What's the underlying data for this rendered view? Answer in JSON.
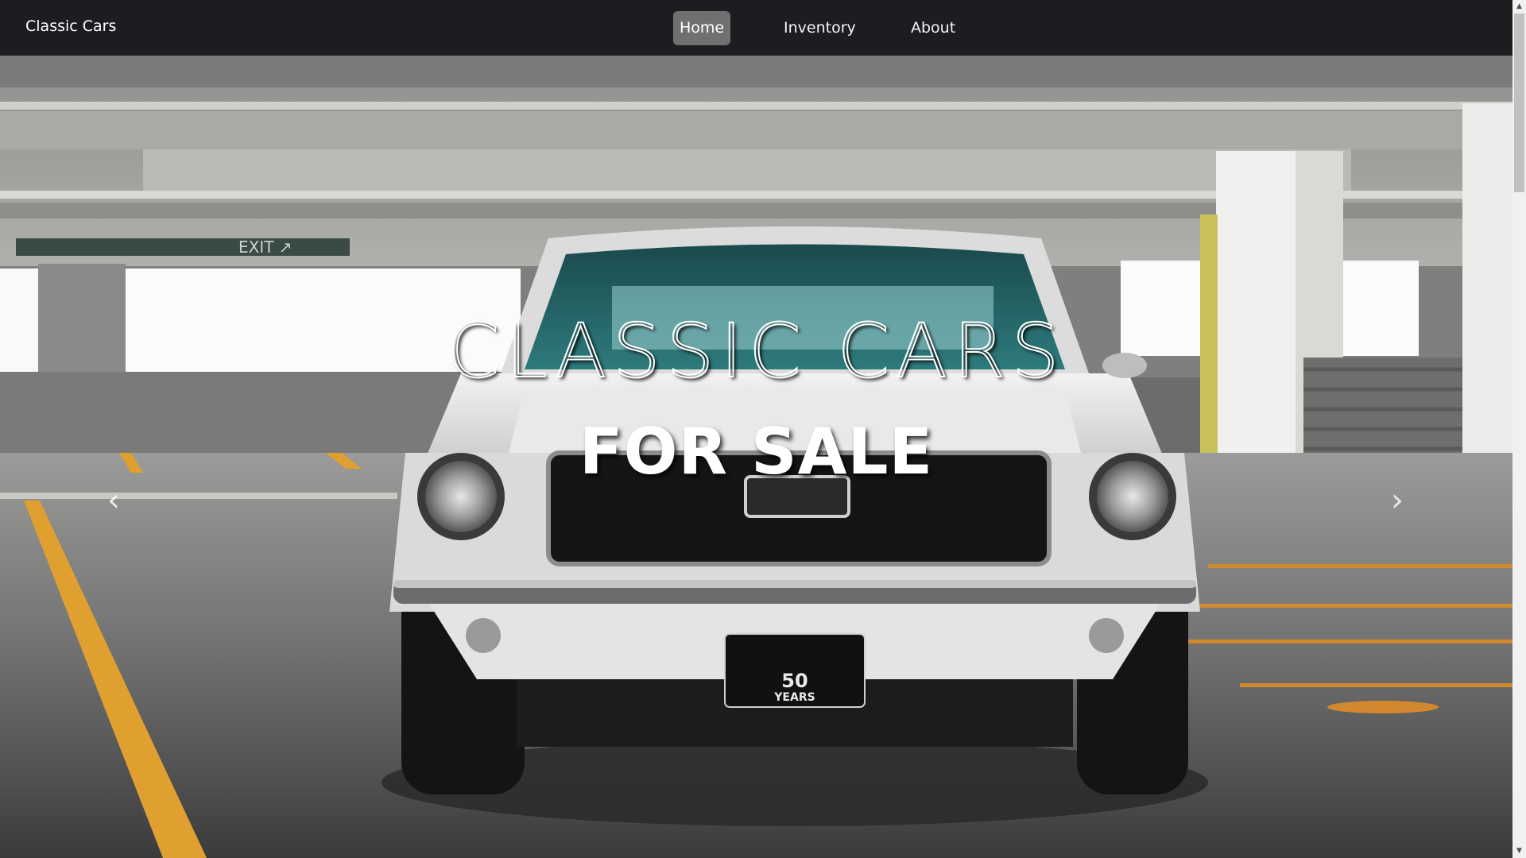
{
  "navbar": {
    "brand": "Classic Cars",
    "items": [
      {
        "label": "Home",
        "active": true
      },
      {
        "label": "Inventory",
        "active": false
      },
      {
        "label": "About",
        "active": false
      }
    ]
  },
  "hero": {
    "headline_1": "CLASSIC CARS",
    "headline_2": "FOR SALE",
    "plate_line_1": "50",
    "plate_line_2": "YEARS",
    "sign_text": "EXIT"
  },
  "carousel": {
    "prev_icon": "chevron-left-icon",
    "next_icon": "chevron-right-icon"
  },
  "colors": {
    "navbar_bg": "#1b1d20",
    "active_nav_bg": "#707070",
    "lane_stripe": "#e0a030"
  }
}
